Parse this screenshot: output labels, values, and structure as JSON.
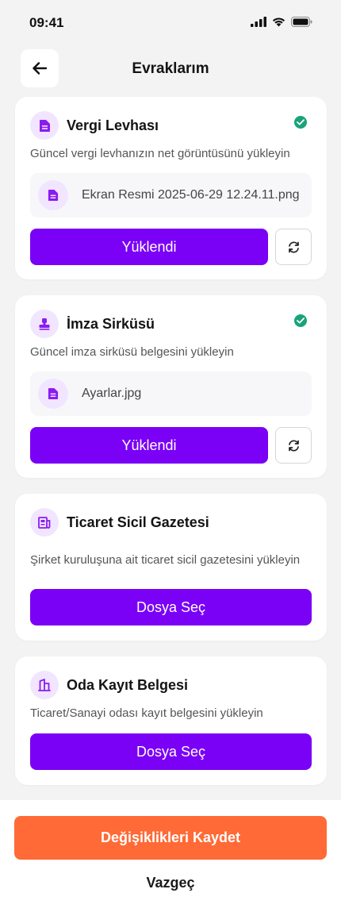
{
  "status_bar": {
    "time": "09:41"
  },
  "header": {
    "title": "Evraklarım",
    "back_icon": "arrow-left-icon"
  },
  "colors": {
    "primary": "#7a00f6",
    "accent": "#ff6a36",
    "success": "#1aa37a",
    "icon_bg": "#f1e5ff"
  },
  "documents": [
    {
      "title": "Vergi Levhası",
      "description": "Güncel vergi levhanızın net görüntüsünü yükleyin",
      "file_name": "Ekran Resmi 2025-06-29 12.24.11.png",
      "button_label": "Yüklendi",
      "uploaded": true,
      "icon": "document-icon"
    },
    {
      "title": "İmza Sirküsü",
      "description": "Güncel imza sirküsü belgesini yükleyin",
      "file_name": "Ayarlar.jpg",
      "button_label": "Yüklendi",
      "uploaded": true,
      "icon": "stamp-icon"
    },
    {
      "title": "Ticaret Sicil Gazetesi",
      "description": "Şirket kuruluşuna ait ticaret sicil gazetesini yükleyin",
      "button_label": "Dosya Seç",
      "uploaded": false,
      "icon": "newspaper-icon"
    },
    {
      "title": "Oda Kayıt Belgesi",
      "description": "Ticaret/Sanayi odası kayıt belgesini yükleyin",
      "button_label": "Dosya Seç",
      "uploaded": false,
      "icon": "building-icon"
    }
  ],
  "footer": {
    "save_label": "Değişiklikleri Kaydet",
    "cancel_label": "Vazgeç"
  }
}
